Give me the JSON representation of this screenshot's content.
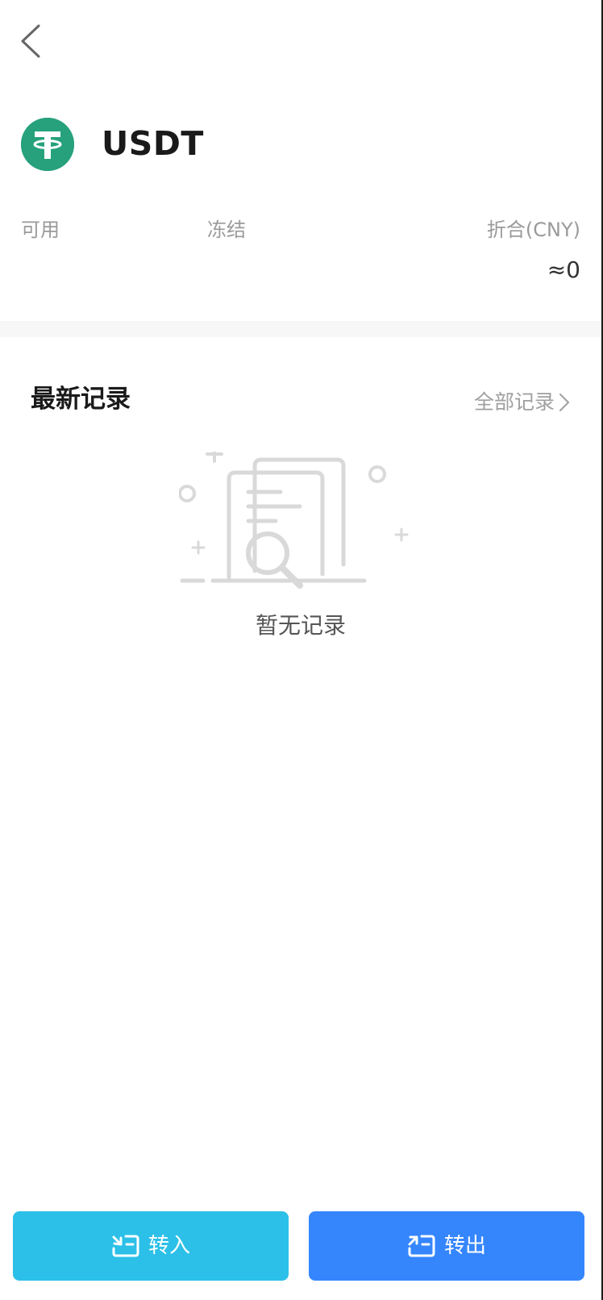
{
  "header": {
    "back_icon": "chevron-left-icon"
  },
  "coin": {
    "symbol": "USDT",
    "logo_icon": "tether-logo-icon",
    "brand_color": "#26a17b"
  },
  "balances": {
    "available_label": "可用",
    "frozen_label": "冻结",
    "cny_label": "折合(CNY)",
    "cny_value": "≈0"
  },
  "records": {
    "title": "最新记录",
    "all_link": "全部记录",
    "empty_text": "暂无记录",
    "empty_icon": "document-search-icon"
  },
  "actions": {
    "deposit_label": "转入",
    "deposit_color": "#2cc0e8",
    "withdraw_label": "转出",
    "withdraw_color": "#3586fd"
  }
}
